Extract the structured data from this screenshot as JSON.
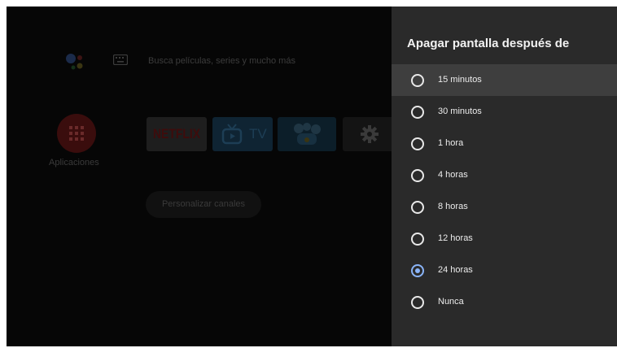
{
  "home": {
    "search_hint": "Busca películas, series y mucho más",
    "apps_label": "Aplicaciones",
    "channels": [
      {
        "name": "Netflix",
        "label": "NETFLIX"
      },
      {
        "name": "Live TV",
        "label": "TV"
      },
      {
        "name": "Games",
        "label": ""
      },
      {
        "name": "Settings",
        "label": ""
      }
    ],
    "customize_button": "Personalizar canales",
    "icons": [
      "google-assistant-icon",
      "keyboard-icon",
      "apps-grid-icon",
      "tv-icon",
      "gamepad-icon",
      "gear-icon"
    ]
  },
  "panel": {
    "title": "Apagar pantalla después de",
    "focused_index": 0,
    "selected_index": 6,
    "options": [
      {
        "label": "15 minutos",
        "selected": false
      },
      {
        "label": "30 minutos",
        "selected": false
      },
      {
        "label": "1 hora",
        "selected": false
      },
      {
        "label": "4 horas",
        "selected": false
      },
      {
        "label": "8 horas",
        "selected": false
      },
      {
        "label": "12 horas",
        "selected": false
      },
      {
        "label": "24 horas",
        "selected": true
      },
      {
        "label": "Nunca",
        "selected": false
      }
    ]
  },
  "colors": {
    "panel_background": "#2a2a2a",
    "focused_row": "#3e3e3e",
    "radio_selected": "#8ab4f8",
    "dim_background": "#060606"
  }
}
